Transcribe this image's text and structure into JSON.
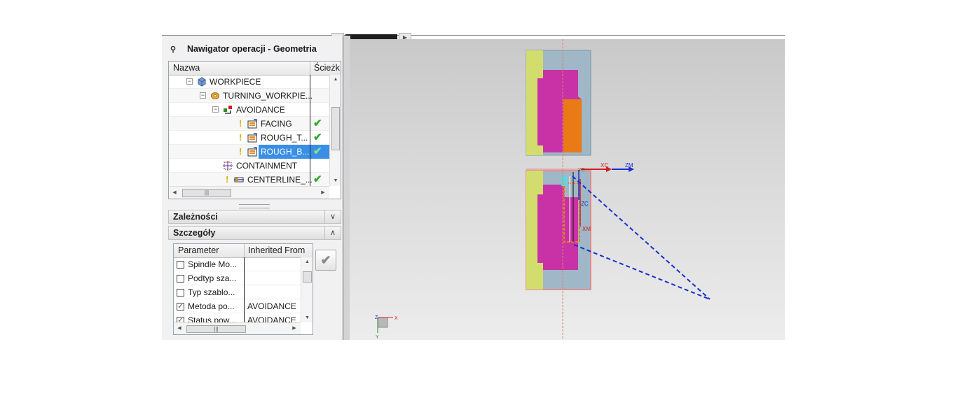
{
  "panel": {
    "title": "Nawigator operacji - Geometria",
    "pin_icon": "pin-icon"
  },
  "tree": {
    "col_name": "Nazwa",
    "col_path": "Ścieżk",
    "rows": [
      {
        "label": "WORKPIECE",
        "icon": "workpiece-icon",
        "status": ""
      },
      {
        "label": "TURNING_WORKPIE...",
        "icon": "turning-workpiece-icon",
        "status": ""
      },
      {
        "label": "AVOIDANCE",
        "icon": "avoidance-icon",
        "status": ""
      },
      {
        "label": "FACING",
        "icon": "turning-operation-icon",
        "status": "ok"
      },
      {
        "label": "ROUGH_T...",
        "icon": "turning-operation-icon",
        "status": "ok"
      },
      {
        "label": "ROUGH_B...",
        "icon": "turning-operation-icon",
        "status": "ok",
        "selected": true
      },
      {
        "label": "CONTAINMENT",
        "icon": "containment-icon",
        "status": ""
      },
      {
        "label": "CENTERLINE_...",
        "icon": "centerline-operation-icon",
        "status": "ok"
      }
    ]
  },
  "sections": {
    "dependencies": "Zależności",
    "details": "Szczegóły"
  },
  "details": {
    "col_param": "Parameter",
    "col_inherited": "Inherited From",
    "rows": [
      {
        "param": "Spindle Mo...",
        "inherited": "",
        "checked": false
      },
      {
        "param": "Podtyp sza...",
        "inherited": "",
        "checked": false
      },
      {
        "param": "Typ szablo...",
        "inherited": "",
        "checked": false
      },
      {
        "param": "Metoda po...",
        "inherited": "AVOIDANCE",
        "checked": true
      },
      {
        "param": "Status pow...",
        "inherited": "AVOIDANCE",
        "checked": true
      }
    ]
  },
  "viewport": {
    "axis_xc": "XC",
    "axis_zm": "ZM",
    "axis_yc": "YC",
    "axis_zc": "ZC",
    "axis_xm": "XM",
    "mini_x": "X",
    "mini_y": "Y",
    "mini_z": "Z",
    "colors": {
      "stock": "#9fb7c6",
      "yellow": "#d2dd6e",
      "magenta": "#c832a6",
      "orange": "#ea7a16",
      "path": "#1a2fcc"
    }
  }
}
